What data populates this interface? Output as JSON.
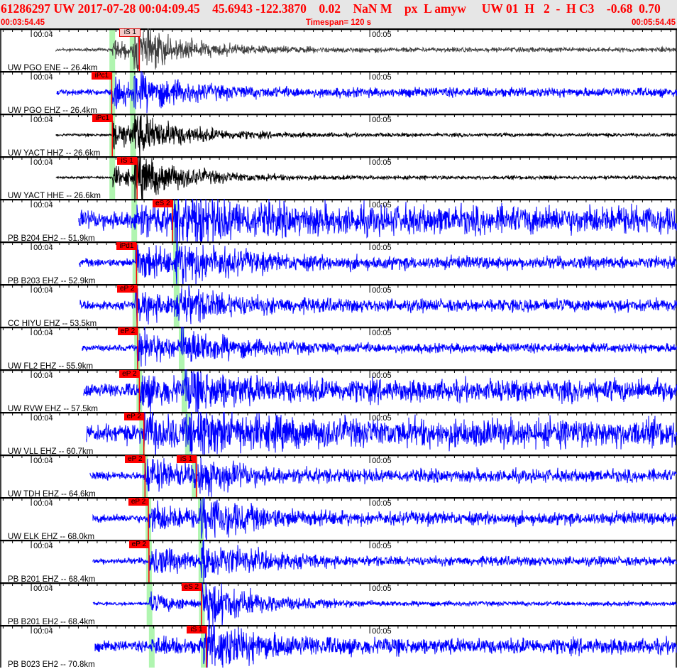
{
  "header": {
    "title": "61286297 UW 2017-07-28 00:04:09.45    45.6943 -122.3870    0.02    NaN M    px  L amyw     UW 01  H   2  -  H C3    -0.68  0.70",
    "start_time": "00:03:54.45",
    "timespan": "Timespan= 120 s",
    "end_time": "00:05:54.45"
  },
  "colors": {
    "header_text": "#ff0000",
    "pick": "#ff0000",
    "pick_faded": "#f5c8c8",
    "theoretical_band": "#b0f5b0",
    "trace_blue": "#0000ff",
    "trace_black": "#000000",
    "trace_gray": "#404040"
  },
  "timespan_s": 120,
  "minute_labels": [
    {
      "label": "00:04",
      "t": 5.55
    },
    {
      "label": "00:05",
      "t": 65.55
    }
  ],
  "traces": [
    {
      "station": "UW PGO ENE -- 26.4km",
      "color": "gray",
      "start": 9.9,
      "p_band": 19.9,
      "s_band": 23.5,
      "picks": [
        {
          "label": "iS 1",
          "t": 24.7,
          "faded": true
        }
      ]
    },
    {
      "station": "UW PGO EHZ -- 26.4km",
      "color": "blue",
      "start": 10.0,
      "p_band": 19.9,
      "s_band": 23.5,
      "picks": [
        {
          "label": "iPc1",
          "t": 19.8
        }
      ]
    },
    {
      "station": "UW YACT HHZ -- 26.6km",
      "color": "black",
      "start": 9.9,
      "p_band": 19.9,
      "s_band": 23.6,
      "picks": [
        {
          "label": "iPc1",
          "t": 19.9
        }
      ]
    },
    {
      "station": "UW YACT HHE -- 26.6km",
      "color": "black",
      "start": 9.9,
      "p_band": 19.9,
      "s_band": 23.8,
      "picks": [
        {
          "label": "iS 1",
          "t": 24.3
        }
      ]
    },
    {
      "station": "PB B204 EH2 -- 51.9km",
      "color": "blue",
      "start": 14.0,
      "p_band": 23.8,
      "s_band": 30.9,
      "picks": [
        {
          "label": "eS 2",
          "t": 30.6
        }
      ]
    },
    {
      "station": "PB B203 EHZ -- 52.9km",
      "color": "blue",
      "start": 14.1,
      "p_band": 24.0,
      "s_band": 31.2,
      "picks": [
        {
          "label": "iPd1",
          "t": 24.2
        }
      ]
    },
    {
      "station": "CC HIYU EHZ -- 53.5km",
      "color": "blue",
      "start": 14.2,
      "p_band": 24.0,
      "s_band": 31.3,
      "picks": [
        {
          "label": "eP 2",
          "t": 24.3
        }
      ]
    },
    {
      "station": "UW FL2 EHZ -- 55.9km",
      "color": "blue",
      "start": 14.6,
      "p_band": 24.3,
      "s_band": 32.2,
      "picks": [
        {
          "label": "eP 2",
          "t": 24.4
        }
      ]
    },
    {
      "station": "UW RVW EHZ -- 57.5km",
      "color": "blue",
      "start": 14.8,
      "p_band": 24.7,
      "s_band": 32.7,
      "picks": [
        {
          "label": "eP 2",
          "t": 24.7
        }
      ]
    },
    {
      "station": "UW VLL EHZ -- 60.7km",
      "color": "blue",
      "start": 15.3,
      "p_band": 25.2,
      "s_band": 33.3,
      "picks": [
        {
          "label": "eP 2",
          "t": 25.5
        }
      ]
    },
    {
      "station": "UW TDH EHZ -- 64.6km",
      "color": "blue",
      "start": 16.0,
      "p_band": 25.7,
      "s_band": 34.5,
      "picks": [
        {
          "label": "eP 2",
          "t": 25.7
        },
        {
          "label": "iS 1",
          "t": 34.8
        }
      ]
    },
    {
      "station": "UW ELK EHZ -- 68.0km",
      "color": "blue",
      "start": 16.5,
      "p_band": 26.3,
      "s_band": 35.6,
      "picks": [
        {
          "label": "eP 2",
          "t": 26.3
        }
      ]
    },
    {
      "station": "PB B201 EHZ -- 68.4km",
      "color": "blue",
      "start": 16.5,
      "p_band": 26.4,
      "s_band": 35.7,
      "picks": [
        {
          "label": "eP 2",
          "t": 26.4
        }
      ]
    },
    {
      "station": "PB B201 EH2 -- 68.4km",
      "color": "blue",
      "start": 16.5,
      "p_band": 26.5,
      "s_band": 35.8,
      "picks": [
        {
          "label": "eS 2",
          "t": 35.7
        }
      ]
    },
    {
      "station": "PB B023 EH2 -- 70.8km",
      "color": "blue",
      "start": 16.9,
      "p_band": 26.9,
      "s_band": 36.1,
      "picks": [
        {
          "label": "iS 1",
          "t": 36.6
        }
      ]
    }
  ]
}
